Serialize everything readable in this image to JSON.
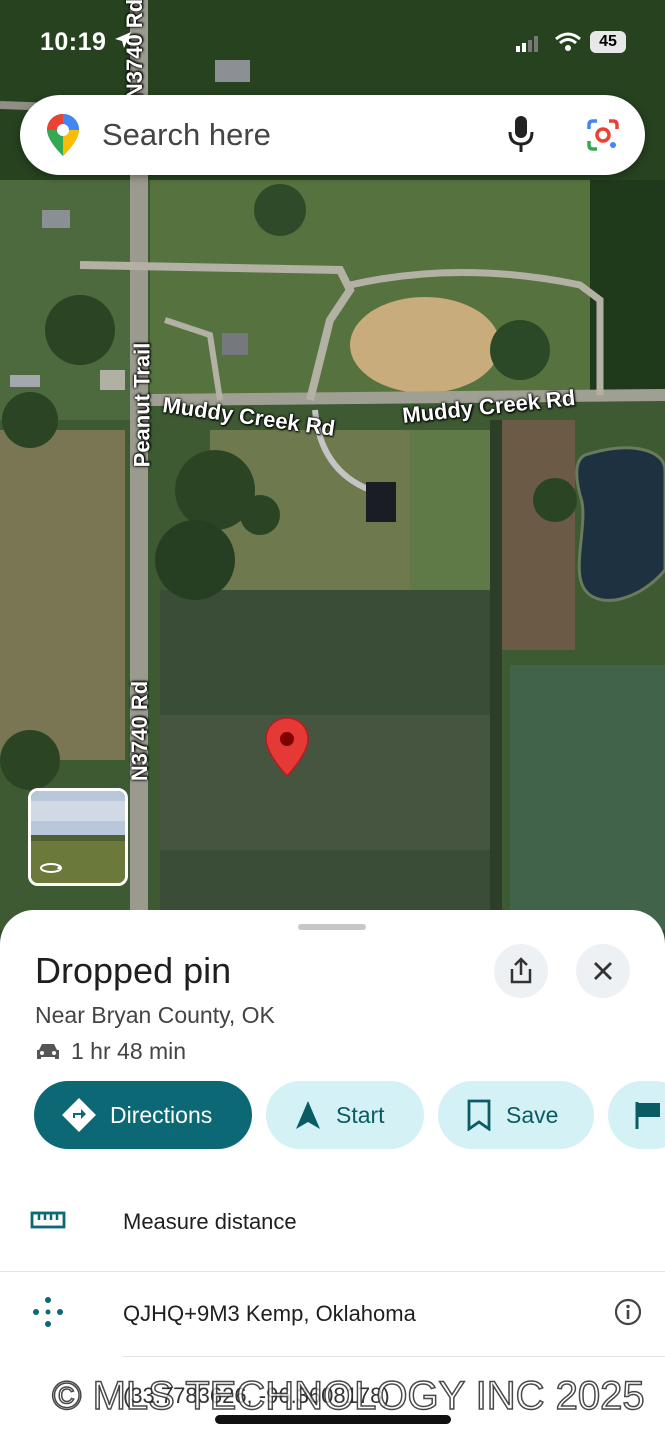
{
  "status_bar": {
    "time": "10:19",
    "battery": "45"
  },
  "search": {
    "placeholder": "Search here"
  },
  "map": {
    "road_labels": {
      "n3740_top": "N3740 Rd",
      "n3740_bottom": "N3740 Rd",
      "peanut_trail": "Peanut Trail",
      "muddy_creek_left": "Muddy Creek Rd",
      "muddy_creek_right": "Muddy Creek Rd"
    }
  },
  "place": {
    "title": "Dropped pin",
    "subtitle": "Near Bryan County, OK",
    "drive_time": "1 hr 48 min"
  },
  "actions": {
    "directions": "Directions",
    "start": "Start",
    "save": "Save"
  },
  "details": {
    "measure": "Measure distance",
    "plus_code": "QJHQ+9M3 Kemp, Oklahoma",
    "coordinates": "(33.7783626, -96.3608178)"
  },
  "watermark": "© MLS TECHNOLOGY INC 2025",
  "colors": {
    "accent": "#0b6874",
    "pill_bg": "#d4f1f6",
    "pin_red": "#e53935"
  }
}
